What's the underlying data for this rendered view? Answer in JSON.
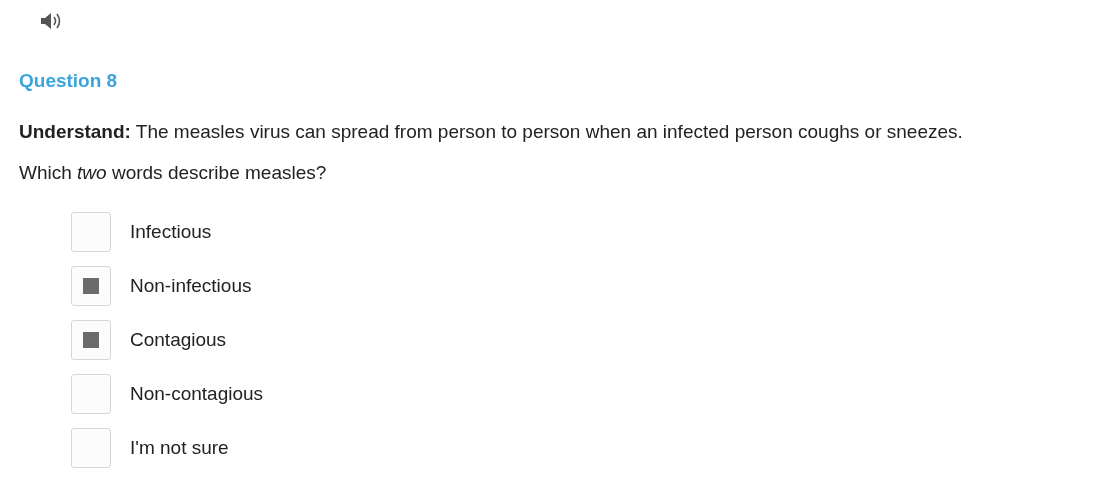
{
  "question": {
    "title": "Question 8",
    "stem": "**Understand:** The measles virus can spread from person to person when an infected person coughs or sneezes.",
    "prompt": "Which *two* words describe measles?"
  },
  "options": [
    {
      "label": "Infectious",
      "checked": false
    },
    {
      "label": "Non-infectious",
      "checked": true
    },
    {
      "label": "Contagious",
      "checked": true
    },
    {
      "label": "Non-contagious",
      "checked": false
    },
    {
      "label": "I'm not sure",
      "checked": false
    }
  ]
}
